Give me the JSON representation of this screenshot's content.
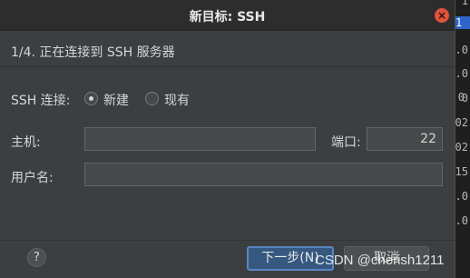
{
  "background_strip": [
    "1",
    "1",
    ".0",
    ".0",
    "0",
    ".0",
    "02",
    "02",
    "15",
    ".0",
    "8.0"
  ],
  "dialog": {
    "title": "新目标: SSH",
    "close_symbol": "×",
    "step_text": "1/4. 正在连接到 SSH 服务器"
  },
  "ssh_connection": {
    "label": "SSH 连接:",
    "options": [
      {
        "label": "新建",
        "selected": true
      },
      {
        "label": "现有",
        "selected": false
      }
    ]
  },
  "host": {
    "label": "主机:",
    "value": ""
  },
  "port": {
    "label": "端口:",
    "value": "22"
  },
  "username": {
    "label": "用户名:",
    "value": ""
  },
  "footer": {
    "help_label": "?",
    "next_label": "下一步(N)",
    "cancel_label": "取消"
  },
  "watermark": "CSDN @cherish1211",
  "colors": {
    "primary_button": "#365880",
    "close_button": "#e0533c",
    "selection": "#2f65ca"
  }
}
